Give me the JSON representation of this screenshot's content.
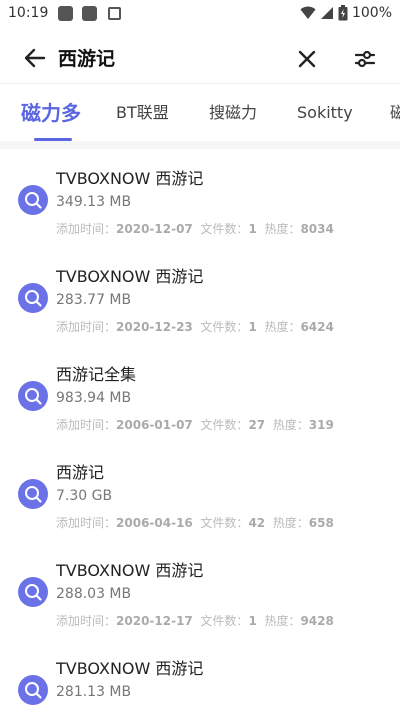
{
  "status_bar": {
    "time": "10:19",
    "battery": "100%"
  },
  "search": {
    "query": "西游记"
  },
  "tabs": [
    {
      "label": "磁力多",
      "active": true
    },
    {
      "label": "BT联盟",
      "active": false
    },
    {
      "label": "搜磁力",
      "active": false
    },
    {
      "label": "Sokitty",
      "active": false
    },
    {
      "label": "磁",
      "active": false
    }
  ],
  "meta_labels": {
    "added": "添加时间：",
    "files": "文件数：",
    "heat": "热度："
  },
  "results": [
    {
      "title": "TVBOXNOW 西游记",
      "size": "349.13 MB",
      "date": "2020-12-07",
      "files": "1",
      "heat": "8034"
    },
    {
      "title": "TVBOXNOW 西游记",
      "size": "283.77 MB",
      "date": "2020-12-23",
      "files": "1",
      "heat": "6424"
    },
    {
      "title": "西游记全集",
      "size": "983.94 MB",
      "date": "2006-01-07",
      "files": "27",
      "heat": "319"
    },
    {
      "title": "西游记",
      "size": "7.30 GB",
      "date": "2006-04-16",
      "files": "42",
      "heat": "658"
    },
    {
      "title": "TVBOXNOW 西游记",
      "size": "288.03 MB",
      "date": "2020-12-17",
      "files": "1",
      "heat": "9428"
    },
    {
      "title": "TVBOXNOW 西游记",
      "size": "281.13 MB",
      "date": "",
      "files": "",
      "heat": ""
    }
  ],
  "colors": {
    "accent": "#5b66e2",
    "icon_bg": "#6b72e8"
  }
}
